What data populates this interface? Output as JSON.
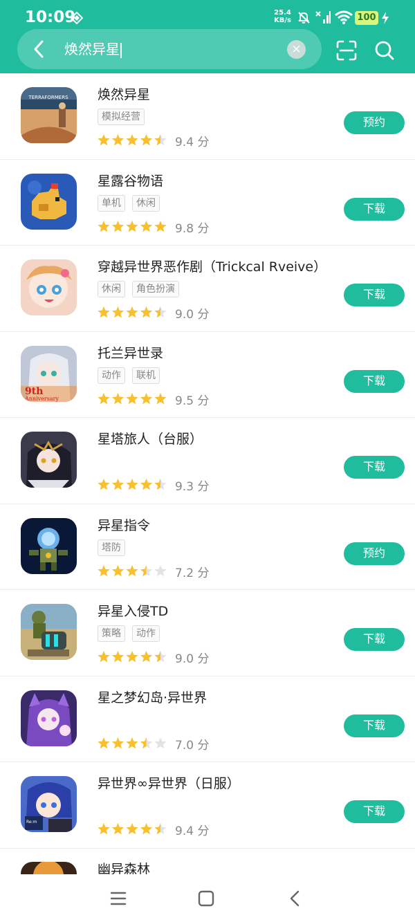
{
  "status": {
    "time": "10:09",
    "net_speed_value": "25.4",
    "net_speed_unit": "KB/s",
    "battery": "100"
  },
  "search": {
    "query": "焕然异星"
  },
  "apps": [
    {
      "name": "焕然异星",
      "tags": [
        "模拟经营"
      ],
      "score": "9.4 分",
      "rating": 4.5,
      "action": "预约"
    },
    {
      "name": "星露谷物语",
      "tags": [
        "单机",
        "休闲"
      ],
      "score": "9.8 分",
      "rating": 5,
      "action": "下载"
    },
    {
      "name": "穿越异世界恶作剧（Trickcal Rveive）",
      "tags": [
        "休闲",
        "角色扮演"
      ],
      "score": "9.0 分",
      "rating": 4.5,
      "action": "下载"
    },
    {
      "name": "托兰异世录",
      "tags": [
        "动作",
        "联机"
      ],
      "score": "9.5 分",
      "rating": 5,
      "action": "下载"
    },
    {
      "name": "星塔旅人（台服）",
      "tags": [],
      "score": "9.3 分",
      "rating": 4.5,
      "action": "下载"
    },
    {
      "name": "异星指令",
      "tags": [
        "塔防"
      ],
      "score": "7.2 分",
      "rating": 3.5,
      "action": "预约"
    },
    {
      "name": "异星入侵TD",
      "tags": [
        "策略",
        "动作"
      ],
      "score": "9.0 分",
      "rating": 4.5,
      "action": "下载"
    },
    {
      "name": "星之梦幻岛·异世界",
      "tags": [],
      "score": "7.0 分",
      "rating": 3.5,
      "action": "下载"
    },
    {
      "name": "异世界∞异世界（日服）",
      "tags": [],
      "score": "9.4 分",
      "rating": 4.5,
      "action": "下载"
    }
  ],
  "partial_app": {
    "name": "幽异森林"
  },
  "colors": {
    "accent": "#1fbd9e",
    "star": "#f9c02d",
    "star_empty": "#e3e3e3"
  }
}
